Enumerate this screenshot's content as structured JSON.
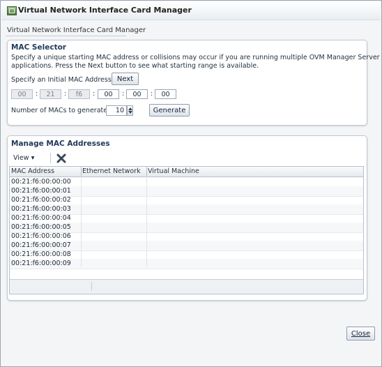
{
  "window": {
    "title": "Virtual Network Interface Card Manager",
    "subtitle": "Virtual Network Interface Card Manager"
  },
  "mac_selector": {
    "title": "MAC Selector",
    "description_line1": "Specify a unique starting MAC address or collisions may occur if you are running multiple OVM Manager Server",
    "description_line2": "applications. Press the Next button to see what starting range is available.",
    "initial_label": "Specify an Initial MAC Address:",
    "next_label": "Next",
    "mac_octets": [
      "00",
      "21",
      "f6",
      "00",
      "00",
      "00"
    ],
    "separator": ":",
    "count_label": "Number of MACs to generate:",
    "count_value": "10",
    "generate_label": "Generate"
  },
  "manage": {
    "title": "Manage MAC Addresses",
    "view_label": "View ▾",
    "columns": [
      "MAC Address",
      "Ethernet Network",
      "Virtual Machine"
    ],
    "rows": [
      {
        "mac": "00:21:f6:00:00:00",
        "network": "",
        "vm": ""
      },
      {
        "mac": "00:21:f6:00:00:01",
        "network": "",
        "vm": ""
      },
      {
        "mac": "00:21:f6:00:00:02",
        "network": "",
        "vm": ""
      },
      {
        "mac": "00:21:f6:00:00:03",
        "network": "",
        "vm": ""
      },
      {
        "mac": "00:21:f6:00:00:04",
        "network": "",
        "vm": ""
      },
      {
        "mac": "00:21:f6:00:00:05",
        "network": "",
        "vm": ""
      },
      {
        "mac": "00:21:f6:00:00:06",
        "network": "",
        "vm": ""
      },
      {
        "mac": "00:21:f6:00:00:07",
        "network": "",
        "vm": ""
      },
      {
        "mac": "00:21:f6:00:00:08",
        "network": "",
        "vm": ""
      },
      {
        "mac": "00:21:f6:00:00:09",
        "network": "",
        "vm": ""
      }
    ]
  },
  "footer": {
    "close_label": "Close"
  },
  "icons": {
    "window": "window-icon",
    "delete": "delete-x-icon",
    "spinner_up": "spinner-up-icon",
    "spinner_down": "spinner-down-icon"
  }
}
